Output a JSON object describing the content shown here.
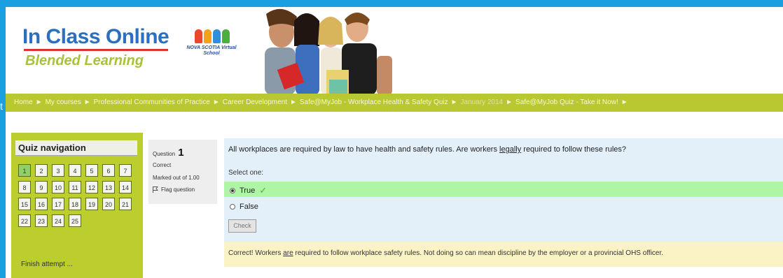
{
  "header": {
    "logo_main": "In Class Online",
    "logo_sub": "Blended Learning",
    "partner_logo_text": "NOVA SCOTIA Virtual School",
    "edge_char": "t"
  },
  "breadcrumb": {
    "items": [
      "Home",
      "My courses",
      "Professional Communities of Practice",
      "Career Development",
      "Safe@MyJob - Workplace Health & Safety Quiz",
      "January 2014",
      "Safe@MyJob Quiz - Take it Now!"
    ],
    "separator": "►"
  },
  "quiz_nav": {
    "title": "Quiz navigation",
    "buttons": [
      "1",
      "2",
      "3",
      "4",
      "5",
      "6",
      "7",
      "8",
      "9",
      "10",
      "11",
      "12",
      "13",
      "14",
      "15",
      "16",
      "17",
      "18",
      "19",
      "20",
      "21",
      "22",
      "23",
      "24",
      "25"
    ],
    "current": "1",
    "finish_label": "Finish attempt ..."
  },
  "question_info": {
    "label": "Question",
    "number": "1",
    "state": "Correct",
    "mark": "Marked out of 1.00",
    "flag_label": "Flag question"
  },
  "question": {
    "text_before": "All workplaces are required by law to have health and safety rules.   Are workers ",
    "text_emph": "legally",
    "text_after": " required to follow these rules?",
    "select_label": "Select one:",
    "options": [
      {
        "label": "True",
        "selected": true,
        "correct": true
      },
      {
        "label": "False",
        "selected": false,
        "correct": false
      }
    ],
    "check_label": "Check"
  },
  "feedback": {
    "before": "Correct!  Workers ",
    "emph": "are",
    "after": " required to follow workplace safety rules.  Not doing so can mean discipline by the employer or a provincial OHS officer."
  },
  "colors": {
    "frame": "#1a9fe0",
    "nav_green": "#b9c830",
    "correct_green": "#aef5a6",
    "question_bg": "#e4f0f9",
    "feedback_bg": "#fbf3c6"
  }
}
